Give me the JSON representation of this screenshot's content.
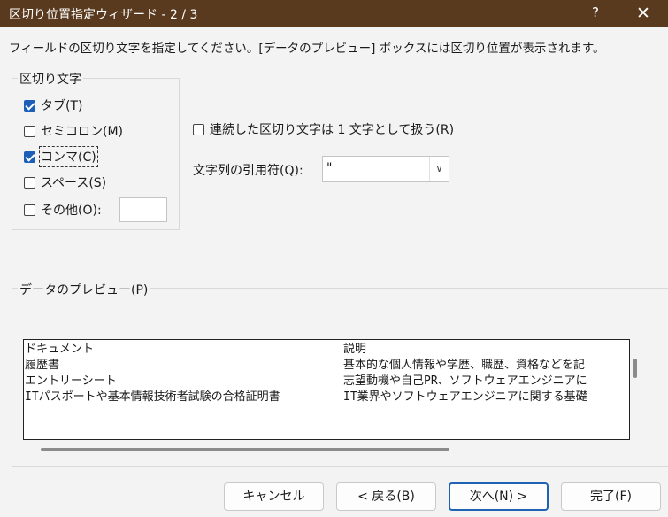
{
  "window": {
    "title": "区切り位置指定ウィザード - 2 / 3",
    "help_label": "?",
    "close_label": "✕"
  },
  "instruction": "フィールドの区切り文字を指定してください。[データのプレビュー] ボックスには区切り位置が表示されます。",
  "delimiters": {
    "legend": "区切り文字",
    "tab": {
      "label": "タブ(T)",
      "checked": true
    },
    "semicolon": {
      "label": "セミコロン(M)",
      "checked": false
    },
    "comma": {
      "label": "コンマ(C)",
      "checked": true
    },
    "space": {
      "label": "スペース(S)",
      "checked": false
    },
    "other": {
      "label": "その他(O):",
      "checked": false,
      "value": ""
    }
  },
  "options": {
    "consecutive": {
      "label": "連続した区切り文字は 1 文字として扱う(R)",
      "checked": false
    },
    "qualifier_label": "文字列の引用符(Q):",
    "qualifier_value": "\""
  },
  "preview": {
    "legend": "データのプレビュー(P)",
    "columns": [
      [
        "ドキュメント",
        "履歴書",
        "エントリーシート",
        "ITパスポートや基本情報技術者試験の合格証明書"
      ],
      [
        "説明",
        "基本的な個人情報や学歴、職歴、資格などを記",
        "志望動機や自己PR、ソフトウェアエンジニアに",
        "IT業界やソフトウェアエンジニアに関する基礎"
      ]
    ]
  },
  "buttons": {
    "cancel": "キャンセル",
    "back": "< 戻る(B)",
    "next": "次へ(N) >",
    "finish": "完了(F)"
  },
  "colors": {
    "titlebar": "#5a3a1e",
    "checked": "#1c5fb8",
    "primary_border": "#1f63b5"
  }
}
